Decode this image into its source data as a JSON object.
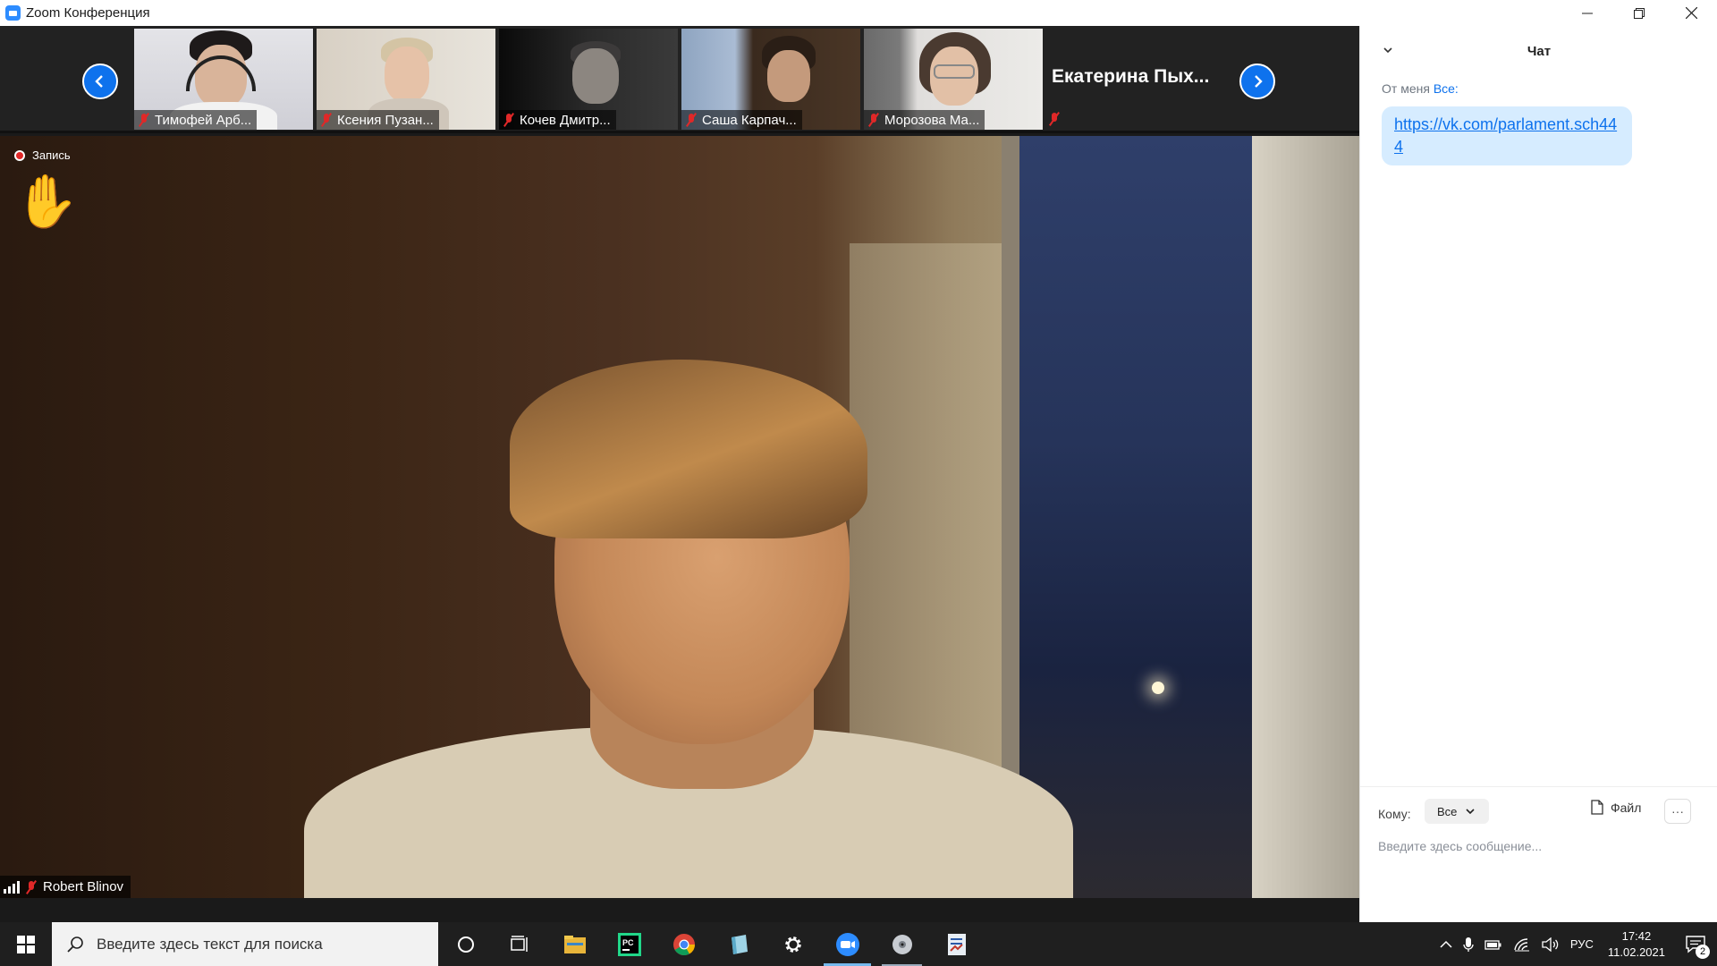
{
  "window": {
    "title": "Zoom Конференция",
    "controls": [
      "minimize",
      "restore",
      "close"
    ]
  },
  "participants_strip": {
    "thumbnails": [
      {
        "name": "Тимофей Арб...",
        "muted": true
      },
      {
        "name": "Ксения Пузан...",
        "muted": true
      },
      {
        "name": "Кочев Дмитр...",
        "muted": true
      },
      {
        "name": "Саша Карпач...",
        "muted": true
      },
      {
        "name": "Морозова Ма...",
        "muted": true
      }
    ],
    "name_tile": {
      "name": "Екатерина Пых...",
      "muted": true
    }
  },
  "main_video": {
    "recording_label": "Запись",
    "hand_raised_icon": "✋",
    "speaker_name": "Robert Blinov",
    "speaker_muted": true
  },
  "chat": {
    "title": "Чат",
    "from_label": "От меня",
    "to_recipient": "Все:",
    "message": "https://vk.com/parlament.sch444",
    "to_label": "Кому:",
    "to_value": "Все",
    "file_label": "Файл",
    "more_label": "···",
    "input_placeholder": "Введите здесь сообщение..."
  },
  "taskbar": {
    "search_placeholder": "Введите здесь текст для поиска",
    "apps": [
      "cortana-icon",
      "task-view-icon",
      "file-explorer-icon",
      "pycharm-icon",
      "chrome-icon",
      "notepad-icon",
      "settings-icon",
      "zoom-icon",
      "disc-icon",
      "document-app-icon"
    ],
    "language": "РУС",
    "time": "17:42",
    "date": "11.02.2021",
    "notification_count": "2"
  },
  "colors": {
    "zoom_blue": "#0e72ed",
    "muted_red": "#e02828",
    "chat_bubble": "#d6ecff"
  }
}
